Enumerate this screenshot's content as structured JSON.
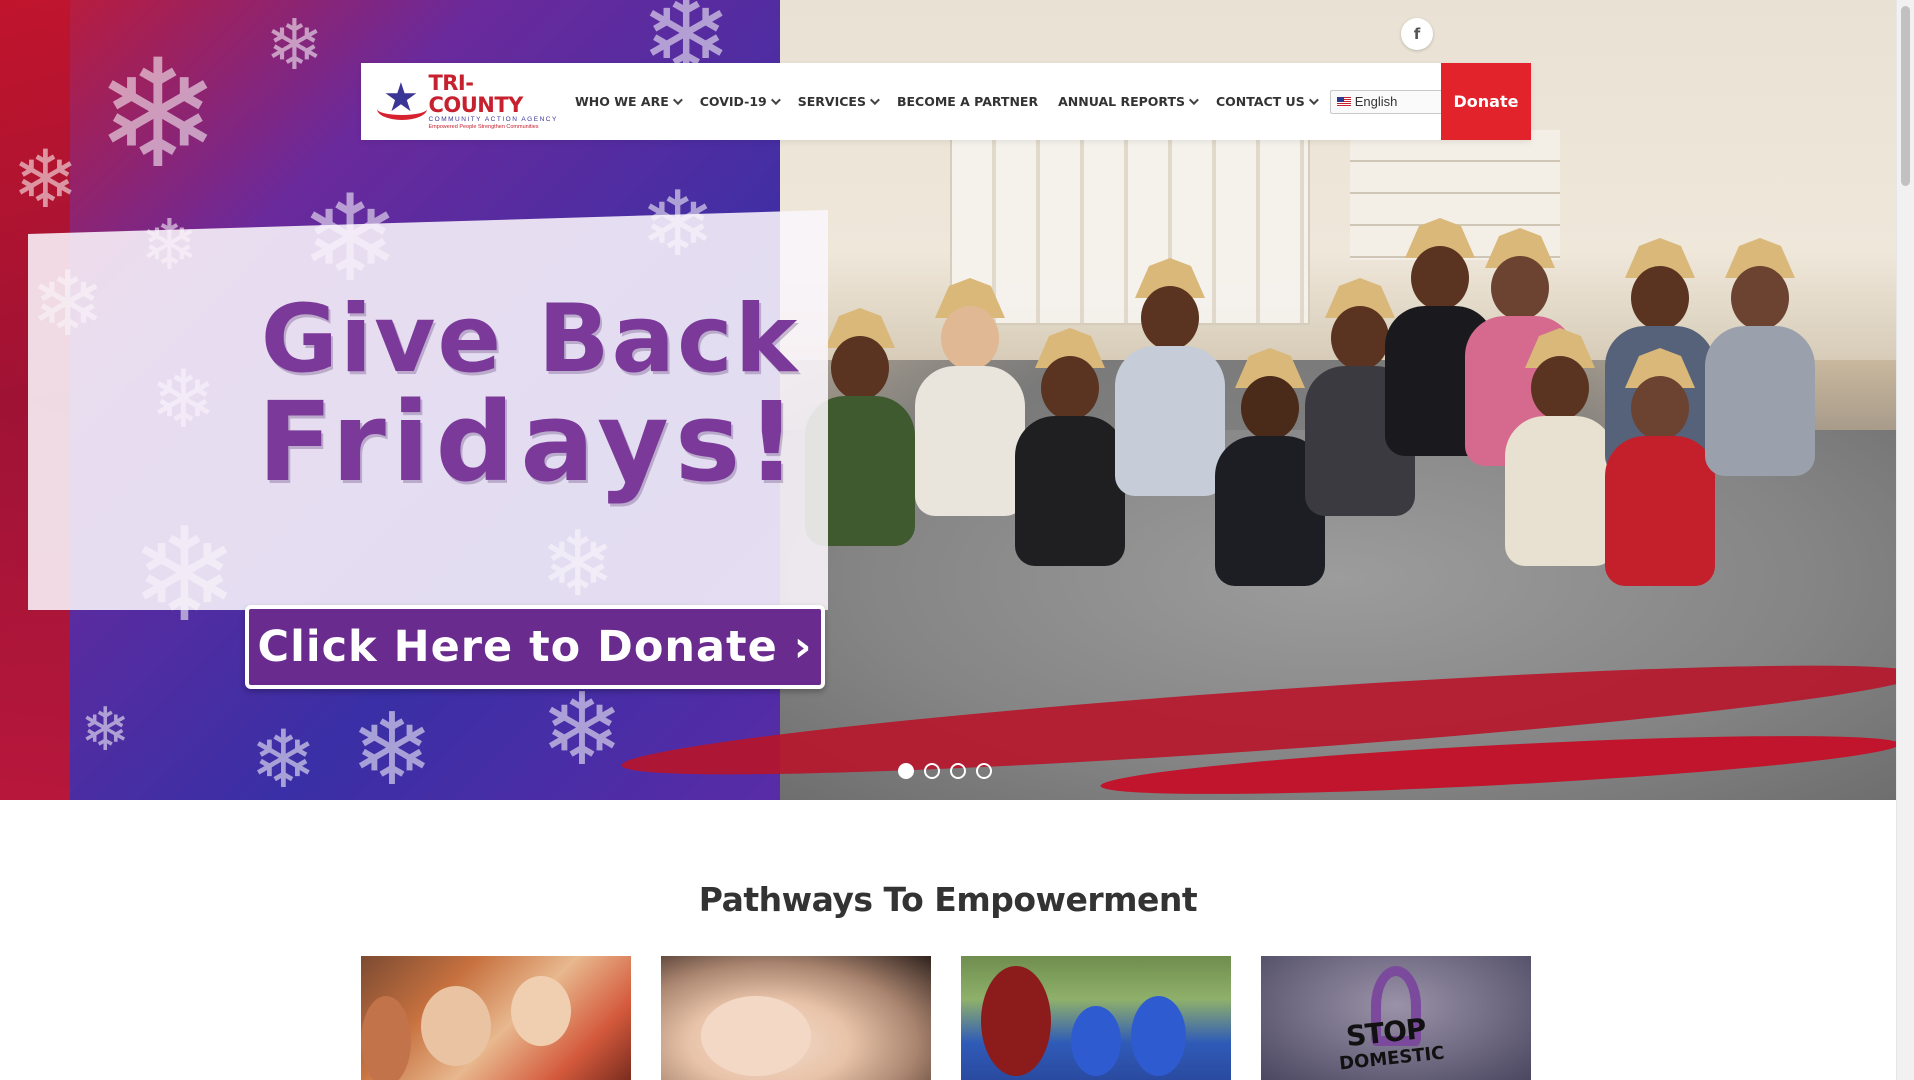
{
  "brand": {
    "name": "TRI-COUNTY",
    "subtitle": "COMMUNITY ACTION AGENCY",
    "tagline": "Empowered People Strengthen Communities"
  },
  "nav": {
    "items": [
      {
        "label": "WHO WE ARE",
        "dropdown": true
      },
      {
        "label": "COVID-19",
        "dropdown": true
      },
      {
        "label": "SERVICES",
        "dropdown": true
      },
      {
        "label": "BECOME A PARTNER",
        "dropdown": false
      },
      {
        "label": "ANNUAL REPORTS",
        "dropdown": true
      },
      {
        "label": "CONTACT US",
        "dropdown": true
      }
    ],
    "language": "English",
    "donate_label": "Donate"
  },
  "social": {
    "facebook_label": "f"
  },
  "hero": {
    "headline_line1": "Give Back",
    "headline_line2": "Fridays!",
    "cta_label": "Click Here to Donate ›",
    "slides_total": 4,
    "active_slide": 1
  },
  "pathways": {
    "title": "Pathways To Empowerment",
    "cards": [
      {
        "icon": "children-photo"
      },
      {
        "icon": "newborn-photo"
      },
      {
        "icon": "outdoor-youth-photo"
      },
      {
        "icon": "stop-domestic-violence-photo",
        "text_line1": "STOP",
        "text_line2": "DOMESTIC"
      }
    ]
  },
  "colors": {
    "accent_red": "#e3232c",
    "headline_purple": "#7b3a99",
    "cta_purple": "#6a2b8f",
    "logo_blue": "#3b3595"
  }
}
